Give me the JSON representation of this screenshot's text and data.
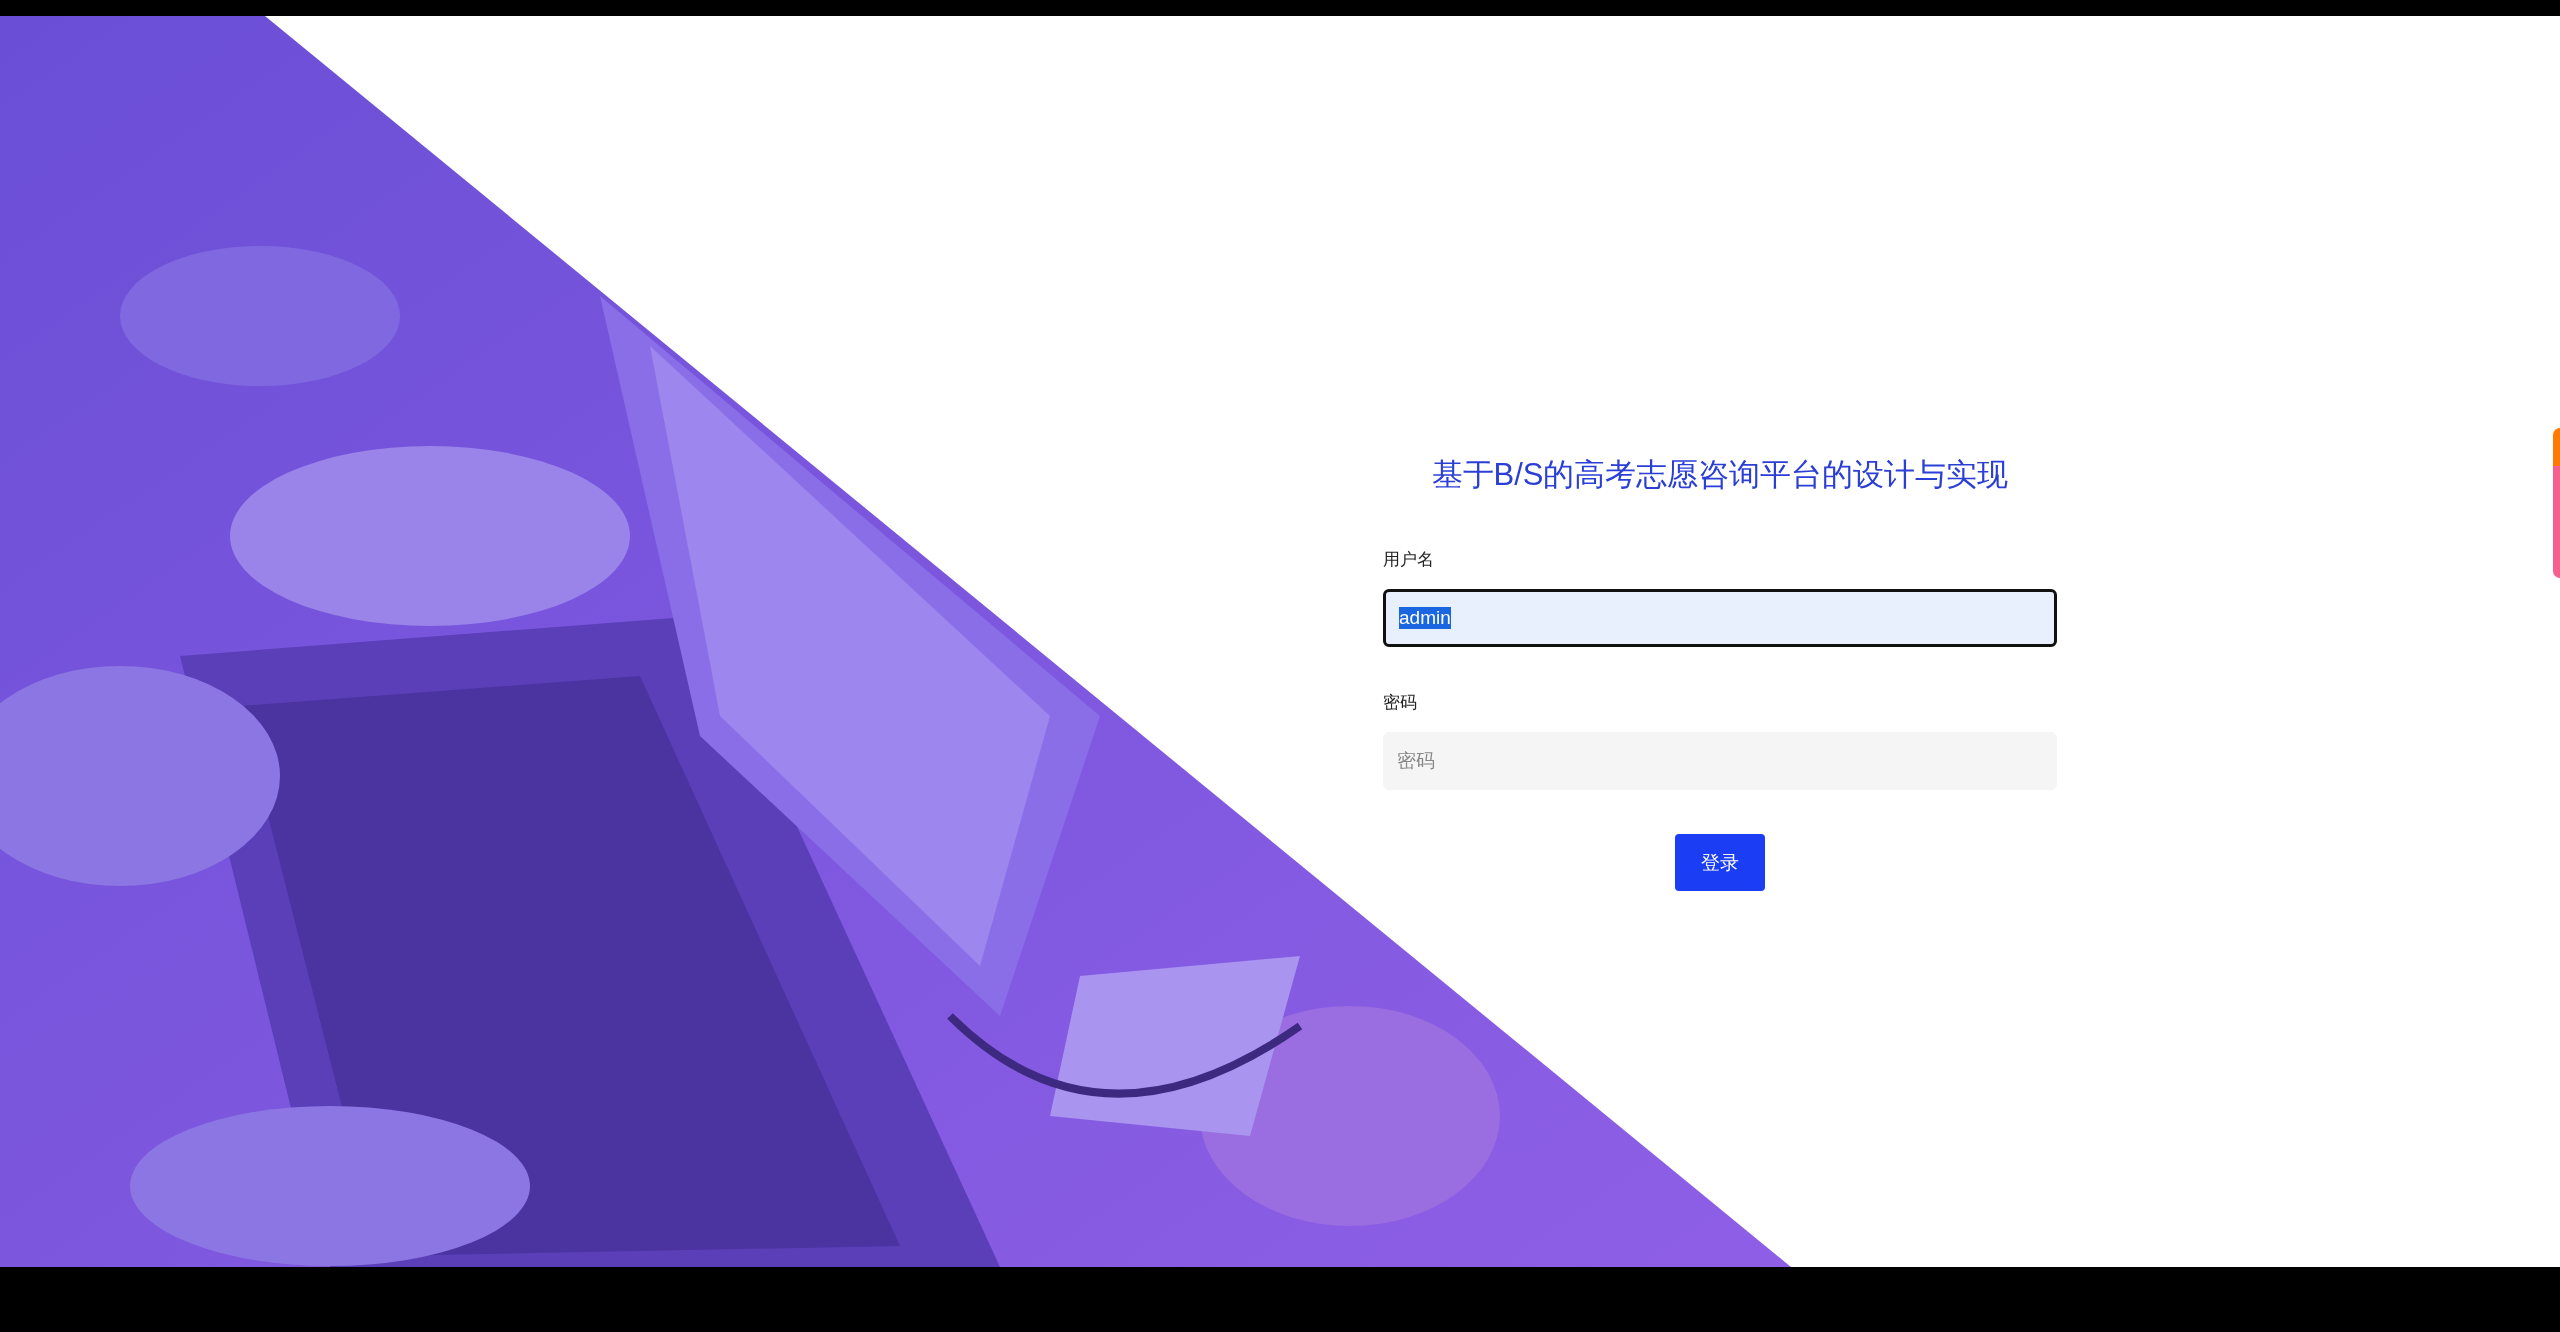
{
  "title": "基于B/S的高考志愿咨询平台的设计与实现",
  "fields": [
    {
      "label": "用户名",
      "value": "admin",
      "focused": true,
      "text_selected": true
    },
    {
      "label": "密码",
      "placeholder": "密码",
      "focused": false
    }
  ],
  "button": "登录"
}
